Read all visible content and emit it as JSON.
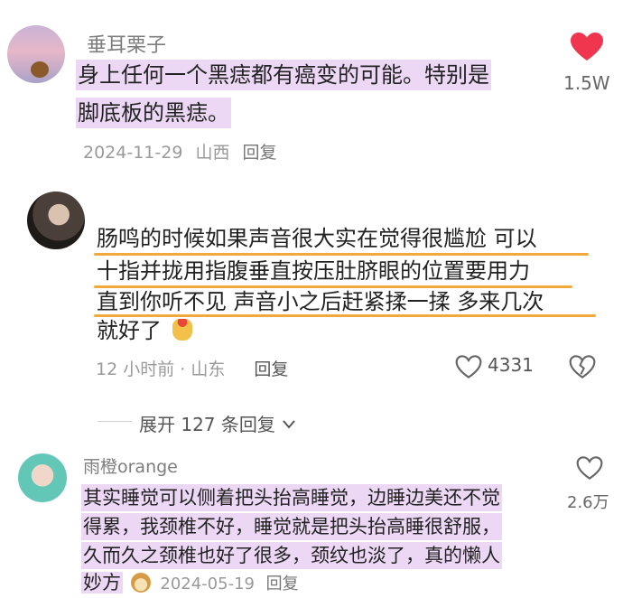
{
  "comments": [
    {
      "username": "垂耳栗子",
      "lines": [
        "身上任何一个黑痣都有癌变的可能。特别是",
        "脚底板的黑痣。"
      ],
      "date": "2024-11-29",
      "location": "山西",
      "reply_label": "回复",
      "like_count": "1.5W",
      "liked": true,
      "colors": {
        "heart": "#f0364f",
        "highlight": "#ecd8f4"
      }
    },
    {
      "lines": [
        "肠鸣的时候如果声音很大实在觉得很尴尬  可以",
        "十指并拢用指腹垂直按压肚脐眼的位置要用力",
        "直到你听不见 声音小之后赶紧揉一揉 多来几次",
        "就好了"
      ],
      "time": "12 小时前 · 山东",
      "reply_label": "回复",
      "like_count": "4331",
      "colors": {
        "underline": "#f2a93b"
      }
    },
    {
      "expand_label": "展开 127 条回复"
    },
    {
      "username": "雨橙orange",
      "lines": [
        "其实睡觉可以侧着把头抬高睡觉，边睡边美还不觉",
        "得累，我颈椎不好，睡觉就是把头抬高睡很舒服，",
        "久而久之颈椎也好了很多，颈纹也淡了，真的懒人",
        "妙方"
      ],
      "date": "2024-05-19",
      "reply_label": "回复",
      "like_count": "2.6万",
      "colors": {
        "highlight": "#ecd8f4"
      }
    }
  ]
}
